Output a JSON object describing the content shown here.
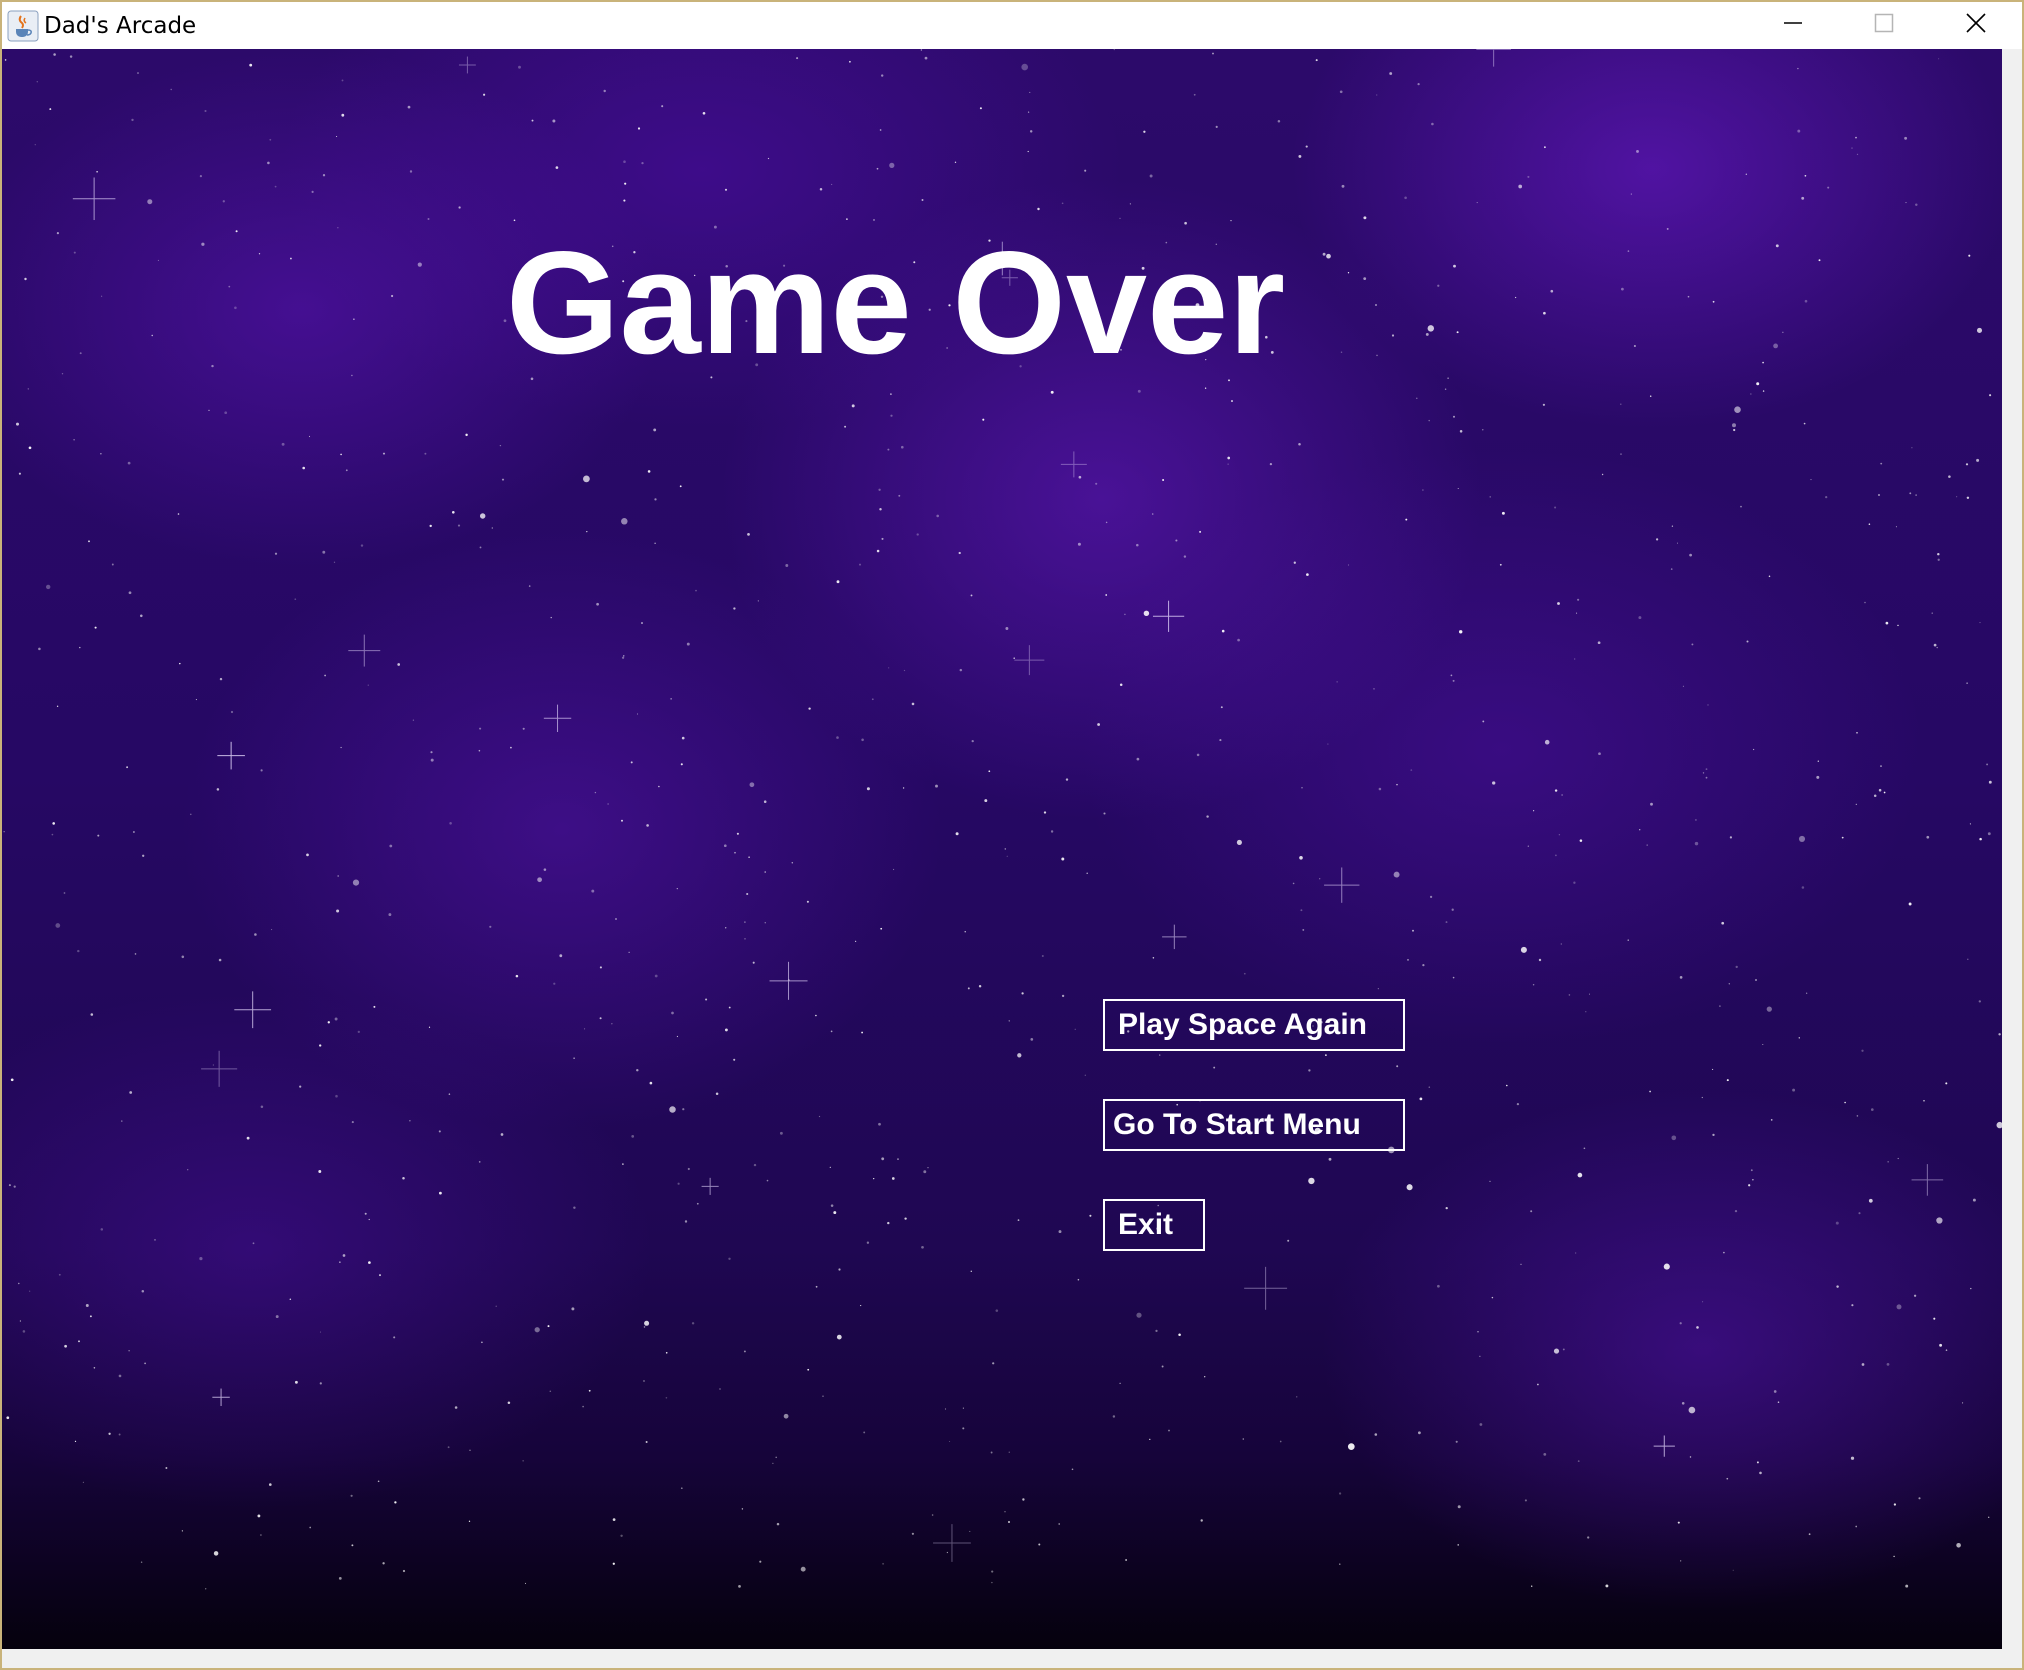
{
  "window": {
    "title": "Dad's Arcade",
    "icon": "java-cup-icon",
    "controls": [
      "minimize-icon",
      "maximize-icon",
      "close-icon"
    ]
  },
  "game": {
    "title": "Game Over",
    "buttons": {
      "play_again": "Play Space Again",
      "start_menu": "Go To Start Menu",
      "exit": "Exit"
    }
  },
  "colors": {
    "background": "#260864",
    "text": "#ffffff",
    "titlebar": "#ffffff"
  }
}
